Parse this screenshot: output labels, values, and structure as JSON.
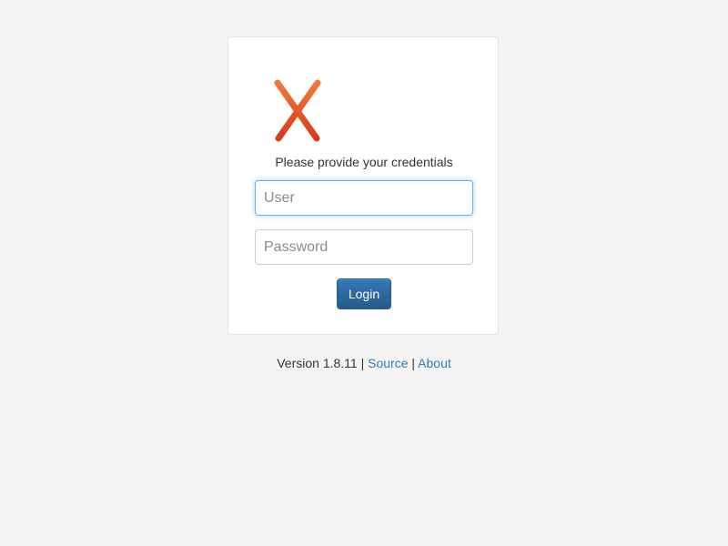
{
  "login": {
    "logo_icon": "x-logo-icon",
    "prompt": "Please provide your credentials",
    "user_placeholder": "User",
    "password_placeholder": "Password",
    "login_label": "Login"
  },
  "footer": {
    "version_text": "Version 1.8.11",
    "separator": "|",
    "source_label": "Source",
    "about_label": "About"
  },
  "colors": {
    "background": "#f4f4f4",
    "link": "#337ab7",
    "button": "#337ab7",
    "logo_light": "#f07a3a",
    "logo_dark": "#d8391c"
  }
}
